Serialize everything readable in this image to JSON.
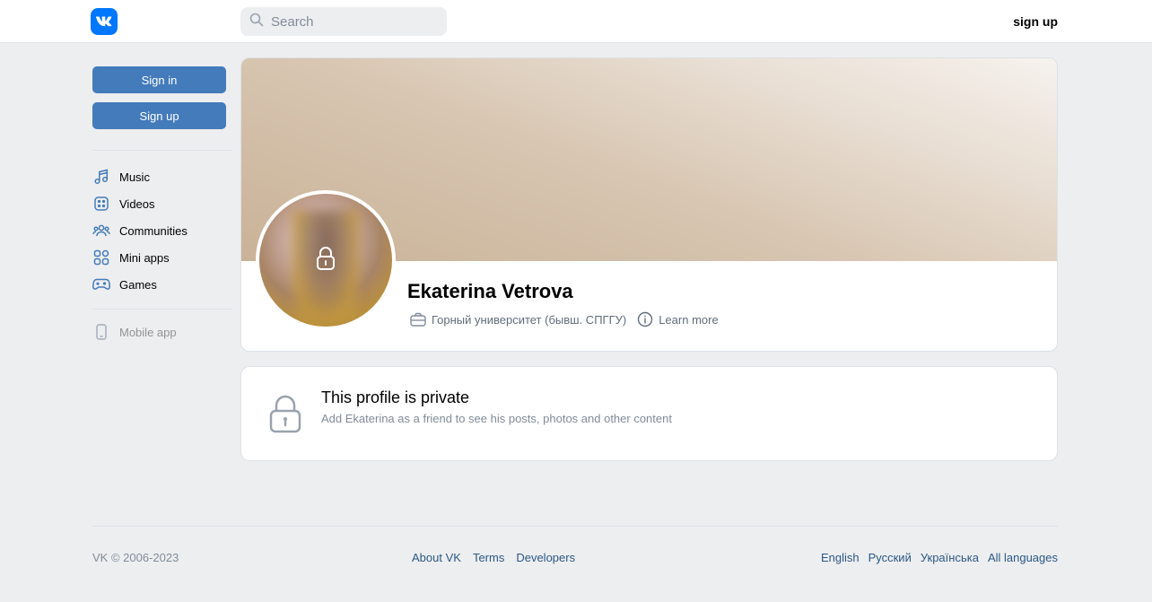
{
  "header": {
    "logo_icon": "vk-logo-icon",
    "search_placeholder": "Search",
    "signup_label": "sign up"
  },
  "sidebar": {
    "signin_label": "Sign in",
    "signup_label": "Sign up",
    "items": [
      {
        "label": "Music",
        "icon": "music-icon"
      },
      {
        "label": "Videos",
        "icon": "video-icon"
      },
      {
        "label": "Communities",
        "icon": "communities-icon"
      },
      {
        "label": "Mini apps",
        "icon": "mini-apps-icon"
      },
      {
        "label": "Games",
        "icon": "gamepad-icon"
      }
    ],
    "mobile_app_label": "Mobile app"
  },
  "profile": {
    "name": "Ekaterina Vetrova",
    "education": "Горный университет (бывш. СПГГУ)",
    "learn_more": "Learn more"
  },
  "private": {
    "title": "This profile is private",
    "subtitle": "Add Ekaterina as a friend to see his posts, photos and other content"
  },
  "footer": {
    "copyright": "VK © 2006-2023",
    "links": [
      "About VK",
      "Terms",
      "Developers"
    ],
    "languages": [
      "English",
      "Русский",
      "Українська",
      "All languages"
    ]
  },
  "colors": {
    "accent": "#447bba",
    "logo": "#0077ff",
    "link": "#2a5885",
    "background": "#edeef0"
  }
}
